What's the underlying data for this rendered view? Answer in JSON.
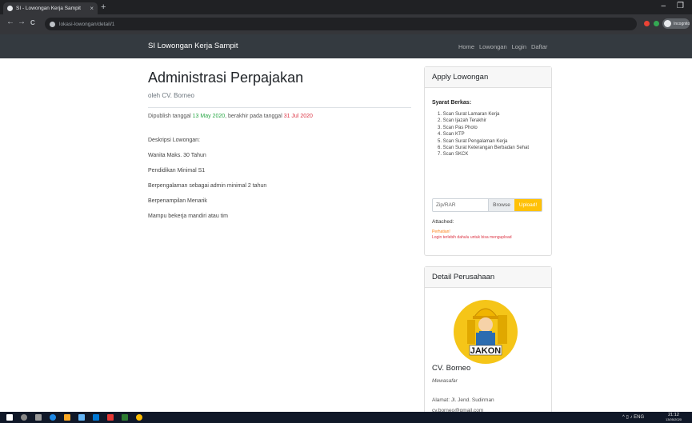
{
  "browser": {
    "tab_title": "SI - Lowongan Kerja Sampit",
    "tab_close": "×",
    "new_tab": "+",
    "url": "lokasi-lowongan/detail/1",
    "min": "–",
    "max": "❐",
    "back": "←",
    "forward": "→",
    "reload": "C",
    "profile_label": "Incognito"
  },
  "navbar": {
    "brand": "SI Lowongan Kerja Sampit",
    "links": [
      "Home",
      "Lowongan",
      "Login",
      "Daftar"
    ]
  },
  "job": {
    "title": "Administrasi Perpajakan",
    "by": "oleh CV. Borneo",
    "published_prefix": "Dipublish tanggal",
    "published_date": "13 May 2020",
    "published_mid": ", berakhir pada tanggal",
    "end_date": "31 Jul 2020",
    "desc_lines": [
      "Deskripsi Lowongan:",
      "Wanita Maks. 30 Tahun",
      "Pendidikan Minimal S1",
      "Berpengalaman sebagai admin minimal 2 tahun",
      "Berpenampilan Menarik",
      "Mampu bekerja mandiri atau tim"
    ]
  },
  "apply": {
    "header": "Apply Lowongan",
    "syarat_title": "Syarat Berkas:",
    "syarat_items": [
      "1. Scan Surat Lamaran Kerja",
      "2. Scan Ijazah Terakhir",
      "3. Scan Pas Photo",
      "4. Scan KTP",
      "5. Scan Surat Pengalaman Kerja",
      "6. Scan Surat Keterangan Berbadan Sehat",
      "7. Scan SKCK"
    ],
    "file_placeholder": "Zip/RAR",
    "browse_label": "Browse",
    "upload_label": "Upload!",
    "attached_label": "Attached:",
    "note_orange": "Perhatian!",
    "note_red": "Login terlebih dahulu untuk bisa mengupload"
  },
  "company": {
    "header": "Detail Perusahaan",
    "logo_text": "JAKON",
    "name": "CV. Borneo",
    "city": "Mewasafar",
    "address": "Alamat: Jl. Jend. Sudirman",
    "email": "cv.borneo@gmail.com"
  },
  "taskbar": {
    "tray": "^ ▯ ♪ ENG",
    "time": "21:12",
    "date": "13/05/2020"
  },
  "colors": {
    "navbar": "#343a40",
    "accent_green": "#28a745",
    "accent_red": "#dc3545",
    "upload_yellow": "#ffc107"
  }
}
